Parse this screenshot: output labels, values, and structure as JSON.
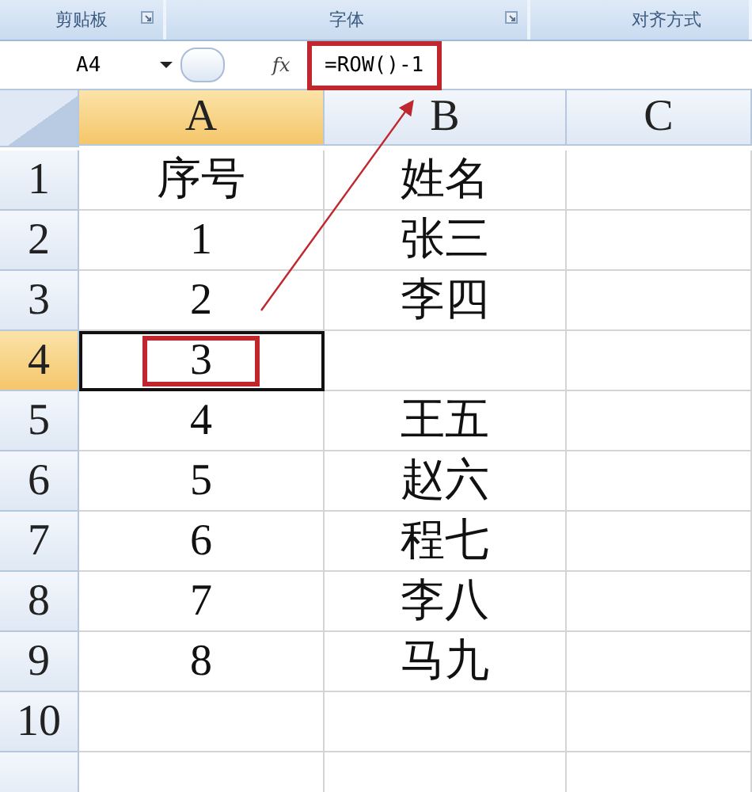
{
  "ribbon_groups": [
    {
      "label": "剪贴板",
      "launcher": true
    },
    {
      "label": "字体",
      "launcher": true
    },
    {
      "label": "对齐方式",
      "launcher": false
    }
  ],
  "formula_bar": {
    "name_box": "A4",
    "fx": "fx",
    "formula": "=ROW()-1",
    "highlighted": true
  },
  "columns": [
    {
      "label": "A",
      "selected": true
    },
    {
      "label": "B",
      "selected": false
    },
    {
      "label": "C",
      "selected": false
    }
  ],
  "rows": [
    {
      "label": "1",
      "selected": false,
      "cells": [
        "序号",
        "姓名",
        ""
      ]
    },
    {
      "label": "2",
      "selected": false,
      "cells": [
        "1",
        "张三",
        ""
      ]
    },
    {
      "label": "3",
      "selected": false,
      "cells": [
        "2",
        "李四",
        ""
      ]
    },
    {
      "label": "4",
      "selected": true,
      "cells": [
        "3",
        "",
        ""
      ],
      "highlighted": true
    },
    {
      "label": "5",
      "selected": false,
      "cells": [
        "4",
        "王五",
        ""
      ]
    },
    {
      "label": "6",
      "selected": false,
      "cells": [
        "5",
        "赵六",
        ""
      ]
    },
    {
      "label": "7",
      "selected": false,
      "cells": [
        "6",
        "程七",
        ""
      ]
    },
    {
      "label": "8",
      "selected": false,
      "cells": [
        "7",
        "李八",
        ""
      ]
    },
    {
      "label": "9",
      "selected": false,
      "cells": [
        "8",
        "马九",
        ""
      ]
    },
    {
      "label": "10",
      "selected": false,
      "cells": [
        "",
        "",
        ""
      ]
    }
  ],
  "callout_arrow": true
}
